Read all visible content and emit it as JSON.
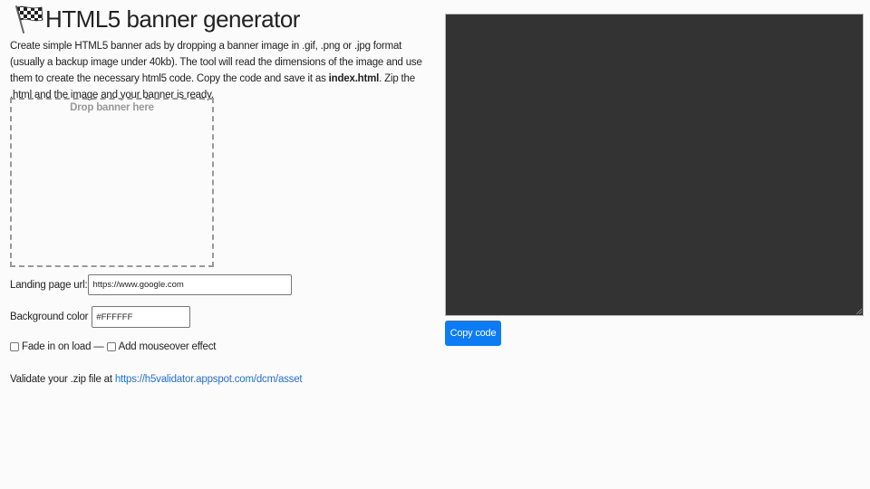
{
  "header": {
    "title": "HTML5 banner generator",
    "icon": "checkered-flag-icon"
  },
  "description": {
    "part1": "Create simple HTML5 banner ads by dropping a banner image in .gif, .png or .jpg format (usually a backup image under 40kb). The tool will read the dimensions of the image and use them to create the necessary html5 code. Copy the code and save it as ",
    "filename": "index.html",
    "part2": ". Zip the .html and the image and your banner is ready."
  },
  "dropzone": {
    "label": "Drop banner here"
  },
  "form": {
    "landing_url_label": "Landing page url:",
    "landing_url_value": "https://www.google.com",
    "bg_color_label": "Background color",
    "bg_color_value": "#FFFFFF",
    "fade_label": "Fade in on load",
    "separator": "—",
    "mouseover_label": "Add mouseover effect"
  },
  "validate": {
    "text": "Validate your .zip file at",
    "link": "https://h5validator.appspot.com/dcm/asset"
  },
  "code_panel": {
    "copy_label": "Copy code",
    "background": "#333333",
    "button_color": "#0d7bf2"
  },
  "colors": {
    "link": "#1a73d9",
    "page_background": "#fbfbfb"
  }
}
